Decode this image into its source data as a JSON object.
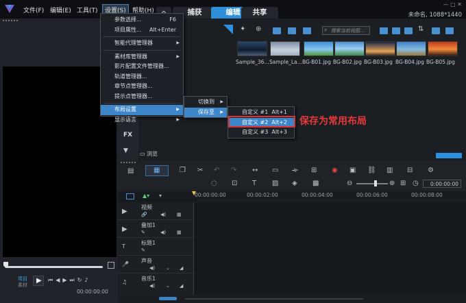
{
  "menubar": {
    "items": [
      "文件(F)",
      "编辑(E)",
      "工具(T)",
      "设置(S)",
      "帮助(H)"
    ]
  },
  "tabs": [
    "捕获",
    "编辑",
    "共享"
  ],
  "file_info": "未命名, 1088*1440",
  "settings_menu": {
    "items": [
      {
        "label": "参数选择...",
        "shortcut": "F6"
      },
      {
        "label": "项目属性...",
        "shortcut": "Alt+Enter"
      },
      {
        "label": "智能代理管理器",
        "submenu": true
      },
      {
        "label": "素材库管理器",
        "submenu": true
      },
      {
        "label": "影片配置文件管理器..."
      },
      {
        "label": "轨道管理器..."
      },
      {
        "label": "章节点管理器..."
      },
      {
        "label": "提示点管理器..."
      },
      {
        "label": "布局设置",
        "submenu": true
      },
      {
        "label": "显示语言",
        "submenu": true
      }
    ]
  },
  "layout_submenu": {
    "items": [
      "切换到",
      "保存至"
    ]
  },
  "save_submenu": {
    "items": [
      {
        "label": "自定义 #1",
        "shortcut": "Alt+1"
      },
      {
        "label": "自定义 #2",
        "shortcut": "Alt+2"
      },
      {
        "label": "自定义 #3",
        "shortcut": "Alt+3"
      }
    ]
  },
  "annotation": "保存为常用布局",
  "library": {
    "search_placeholder": "搜索当前视图...",
    "thumbnails": [
      "Sample_36...",
      "Sample_La...",
      "BG-B01.jpg",
      "BG-B02.jpg",
      "BG-B03.jpg",
      "BG-B04.jpg",
      "BG-B05.jpg"
    ],
    "side_fx": "FX",
    "browse": "浏览"
  },
  "timeline": {
    "ruler": [
      "00:00:00:00",
      "00:00:02:00",
      "00:00:04:00",
      "00:00:06:00",
      "00:00:08:00"
    ],
    "timecode": "0:00:00:00",
    "tracks": [
      "视频",
      "叠加1",
      "标题1",
      "声音",
      "音乐1"
    ]
  },
  "player": {
    "project_label": "项目",
    "clip_label": "素材",
    "timecode": "00:00:00:00"
  }
}
